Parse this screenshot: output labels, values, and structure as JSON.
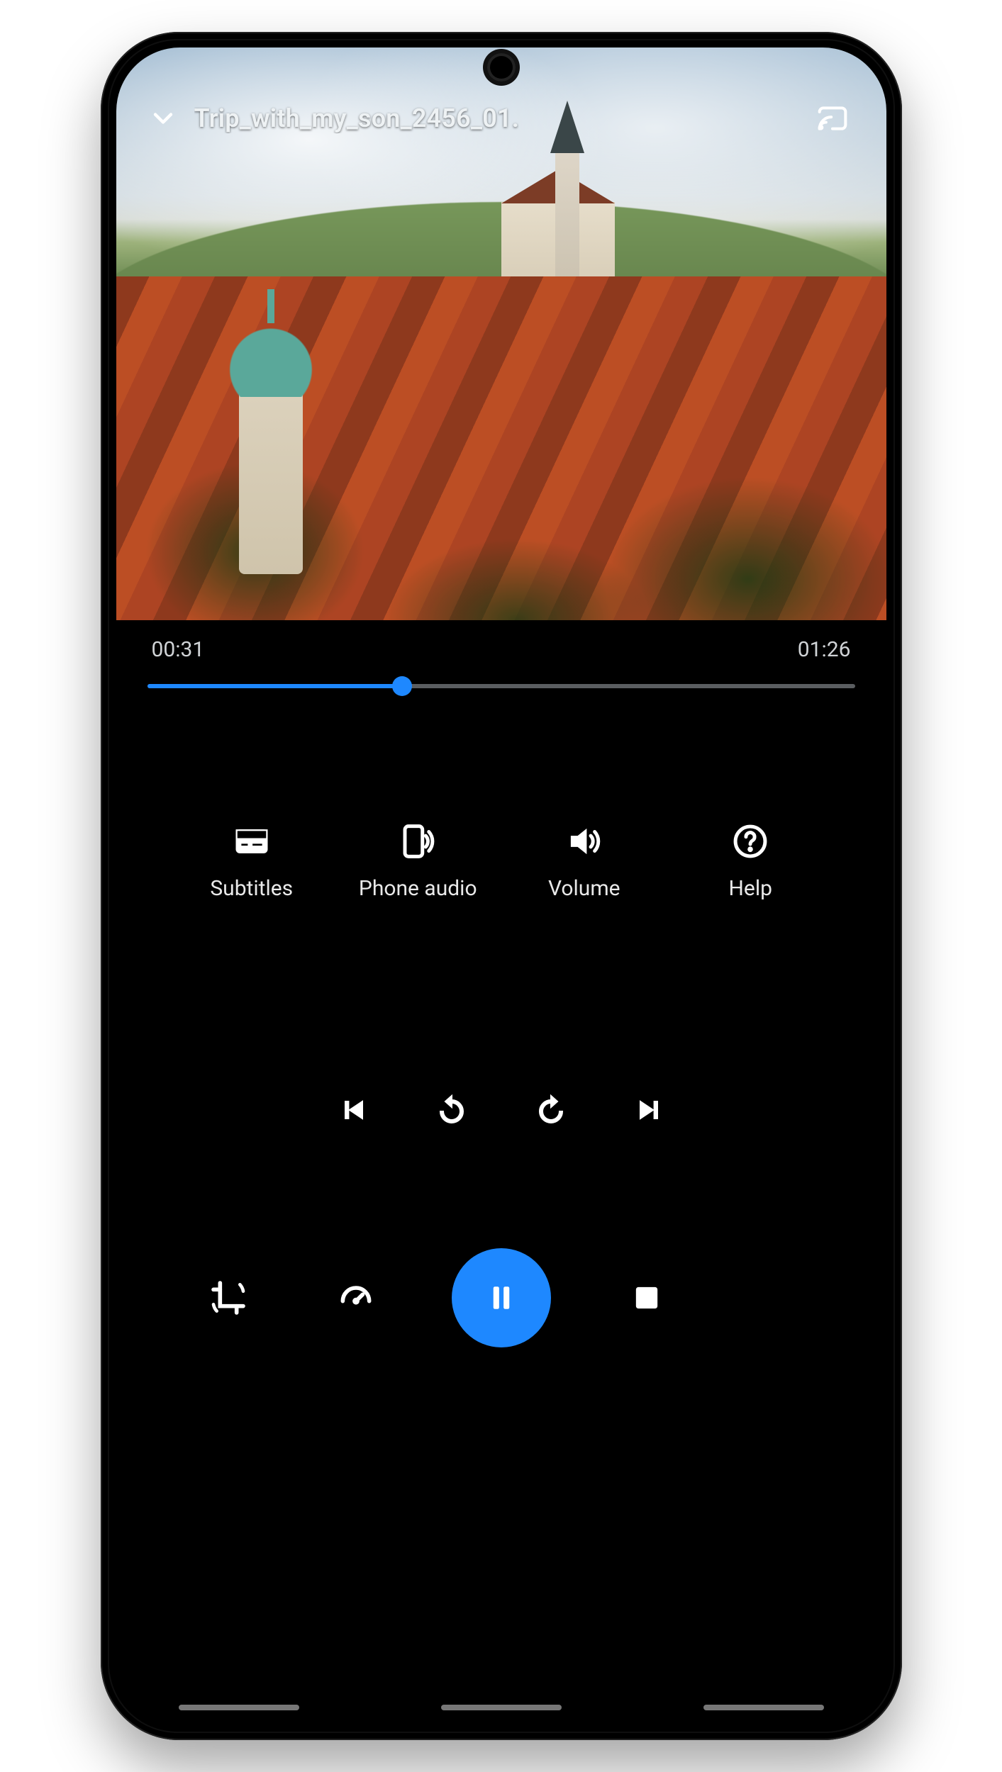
{
  "header": {
    "title": "Trip_with_my_son_2456_01."
  },
  "playback": {
    "current_time": "00:31",
    "total_time": "01:26",
    "progress_pct": 36
  },
  "options": {
    "subtitles": "Subtitles",
    "phone_audio": "Phone audio",
    "volume": "Volume",
    "help": "Help"
  },
  "colors": {
    "accent": "#1e88ff"
  }
}
